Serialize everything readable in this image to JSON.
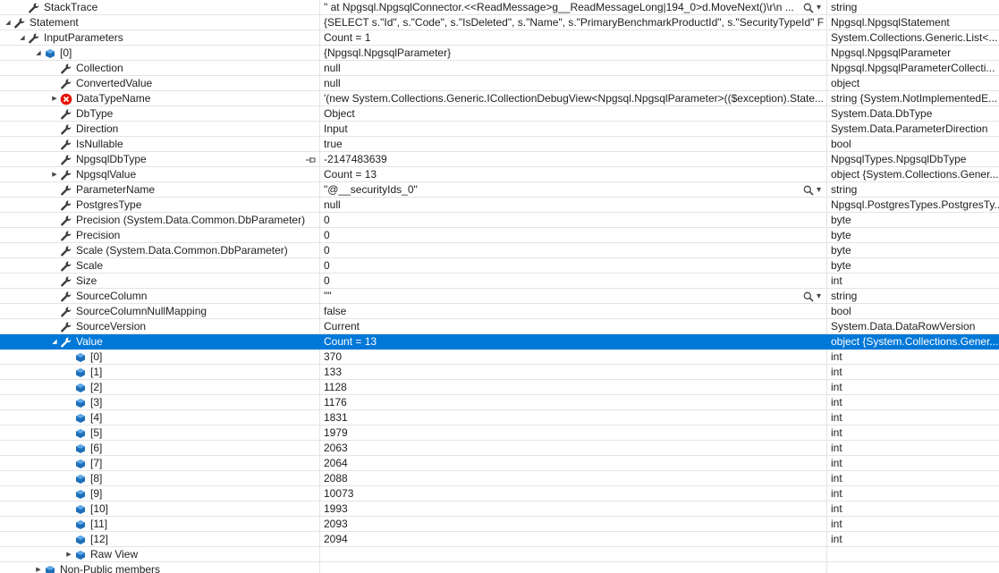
{
  "rows": [
    {
      "name": "StackTrace",
      "value": "\"   at Npgsql.NpgsqlConnector.<<ReadMessage>g__ReadMessageLong|194_0>d.MoveNext()\\r\\n   ...",
      "type": "string",
      "depth": 1,
      "expander": "none",
      "icon": "property",
      "viz": true
    },
    {
      "name": "Statement",
      "value": "{SELECT s.\"Id\", s.\"Code\", s.\"IsDeleted\", s.\"Name\", s.\"PrimaryBenchmarkProductId\", s.\"SecurityTypeId\" FRO...",
      "type": "Npgsql.NpgsqlStatement",
      "depth": 0,
      "expander": "expanded",
      "icon": "property"
    },
    {
      "name": "InputParameters",
      "value": "Count = 1",
      "type": "System.Collections.Generic.List<...",
      "depth": 1,
      "expander": "expanded",
      "icon": "property"
    },
    {
      "name": "[0]",
      "value": "{Npgsql.NpgsqlParameter}",
      "type": "Npgsql.NpgsqlParameter",
      "depth": 2,
      "expander": "expanded",
      "icon": "field"
    },
    {
      "name": "Collection",
      "value": "null",
      "type": "Npgsql.NpgsqlParameterCollecti...",
      "depth": 3,
      "expander": "none",
      "icon": "property"
    },
    {
      "name": "ConvertedValue",
      "value": "null",
      "type": "object",
      "depth": 3,
      "expander": "none",
      "icon": "property"
    },
    {
      "name": "DataTypeName",
      "value": "'(new System.Collections.Generic.ICollectionDebugView<Npgsql.NpgsqlParameter>(($exception).State...",
      "type": "string {System.NotImplementedE...",
      "depth": 3,
      "expander": "collapsed",
      "icon": "error"
    },
    {
      "name": "DbType",
      "value": "Object",
      "type": "System.Data.DbType",
      "depth": 3,
      "expander": "none",
      "icon": "property"
    },
    {
      "name": "Direction",
      "value": "Input",
      "type": "System.Data.ParameterDirection",
      "depth": 3,
      "expander": "none",
      "icon": "property"
    },
    {
      "name": "IsNullable",
      "value": "true",
      "type": "bool",
      "depth": 3,
      "expander": "none",
      "icon": "property"
    },
    {
      "name": "NpgsqlDbType",
      "value": "-2147483639",
      "type": "NpgsqlTypes.NpgsqlDbType",
      "depth": 3,
      "expander": "none",
      "icon": "property",
      "pin": true
    },
    {
      "name": "NpgsqlValue",
      "value": "Count = 13",
      "type": "object {System.Collections.Gener...",
      "depth": 3,
      "expander": "collapsed",
      "icon": "property"
    },
    {
      "name": "ParameterName",
      "value": "\"@__securityIds_0\"",
      "type": "string",
      "depth": 3,
      "expander": "none",
      "icon": "property",
      "viz": true
    },
    {
      "name": "PostgresType",
      "value": "null",
      "type": "Npgsql.PostgresTypes.PostgresTy...",
      "depth": 3,
      "expander": "none",
      "icon": "property"
    },
    {
      "name": "Precision (System.Data.Common.DbParameter)",
      "value": "0",
      "type": "byte",
      "depth": 3,
      "expander": "none",
      "icon": "property"
    },
    {
      "name": "Precision",
      "value": "0",
      "type": "byte",
      "depth": 3,
      "expander": "none",
      "icon": "property"
    },
    {
      "name": "Scale (System.Data.Common.DbParameter)",
      "value": "0",
      "type": "byte",
      "depth": 3,
      "expander": "none",
      "icon": "property"
    },
    {
      "name": "Scale",
      "value": "0",
      "type": "byte",
      "depth": 3,
      "expander": "none",
      "icon": "property"
    },
    {
      "name": "Size",
      "value": "0",
      "type": "int",
      "depth": 3,
      "expander": "none",
      "icon": "property"
    },
    {
      "name": "SourceColumn",
      "value": "\"\"",
      "type": "string",
      "depth": 3,
      "expander": "none",
      "icon": "property",
      "viz": true
    },
    {
      "name": "SourceColumnNullMapping",
      "value": "false",
      "type": "bool",
      "depth": 3,
      "expander": "none",
      "icon": "property"
    },
    {
      "name": "SourceVersion",
      "value": "Current",
      "type": "System.Data.DataRowVersion",
      "depth": 3,
      "expander": "none",
      "icon": "property"
    },
    {
      "name": "Value",
      "value": "Count = 13",
      "type": "object {System.Collections.Gener...",
      "depth": 3,
      "expander": "expanded",
      "icon": "property-search",
      "selected": true
    },
    {
      "name": "[0]",
      "value": "370",
      "type": "int",
      "depth": 4,
      "expander": "none",
      "icon": "field"
    },
    {
      "name": "[1]",
      "value": "133",
      "type": "int",
      "depth": 4,
      "expander": "none",
      "icon": "field"
    },
    {
      "name": "[2]",
      "value": "1128",
      "type": "int",
      "depth": 4,
      "expander": "none",
      "icon": "field"
    },
    {
      "name": "[3]",
      "value": "1176",
      "type": "int",
      "depth": 4,
      "expander": "none",
      "icon": "field"
    },
    {
      "name": "[4]",
      "value": "1831",
      "type": "int",
      "depth": 4,
      "expander": "none",
      "icon": "field"
    },
    {
      "name": "[5]",
      "value": "1979",
      "type": "int",
      "depth": 4,
      "expander": "none",
      "icon": "field"
    },
    {
      "name": "[6]",
      "value": "2063",
      "type": "int",
      "depth": 4,
      "expander": "none",
      "icon": "field"
    },
    {
      "name": "[7]",
      "value": "2064",
      "type": "int",
      "depth": 4,
      "expander": "none",
      "icon": "field"
    },
    {
      "name": "[8]",
      "value": "2088",
      "type": "int",
      "depth": 4,
      "expander": "none",
      "icon": "field"
    },
    {
      "name": "[9]",
      "value": "10073",
      "type": "int",
      "depth": 4,
      "expander": "none",
      "icon": "field"
    },
    {
      "name": "[10]",
      "value": "1993",
      "type": "int",
      "depth": 4,
      "expander": "none",
      "icon": "field"
    },
    {
      "name": "[11]",
      "value": "2093",
      "type": "int",
      "depth": 4,
      "expander": "none",
      "icon": "field"
    },
    {
      "name": "[12]",
      "value": "2094",
      "type": "int",
      "depth": 4,
      "expander": "none",
      "icon": "field"
    },
    {
      "name": "Raw View",
      "value": "",
      "type": "",
      "depth": 4,
      "expander": "collapsed",
      "icon": "field"
    },
    {
      "name": "Non-Public members",
      "value": "",
      "type": "",
      "depth": 2,
      "expander": "collapsed",
      "icon": "field"
    }
  ],
  "colors": {
    "selected_bg": "#0078d7",
    "field_icon": "#1e6fb8",
    "error_icon": "#e51400",
    "wrench_icon": "#3c3c3c"
  }
}
